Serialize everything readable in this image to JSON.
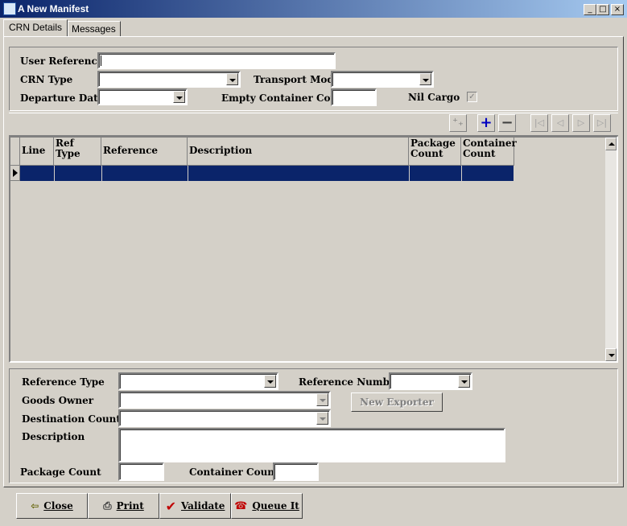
{
  "window": {
    "title": "A New Manifest",
    "controls": [
      "_",
      "□",
      "×"
    ]
  },
  "tabs": [
    {
      "label": "CRN Details"
    },
    {
      "label": "Messages"
    }
  ],
  "header_form": {
    "user_reference": {
      "label": "User Reference",
      "value": ""
    },
    "crn_type": {
      "label": "CRN Type",
      "value": ""
    },
    "transport_mode": {
      "label": "Transport Mode",
      "value": ""
    },
    "departure_date": {
      "label": "Departure Date",
      "value": ""
    },
    "empty_container_count": {
      "label": "Empty Container Count",
      "value": ""
    },
    "nil_cargo": {
      "label": "Nil Cargo",
      "checked": true
    }
  },
  "grid": {
    "columns": [
      {
        "label": "Line"
      },
      {
        "label": "Ref Type"
      },
      {
        "label": "Reference"
      },
      {
        "label": "Description"
      },
      {
        "label": "Package Count"
      },
      {
        "label": "Container Count"
      }
    ],
    "selected_row_color": "#0a246a"
  },
  "detail_form": {
    "reference_type": {
      "label": "Reference Type",
      "value": ""
    },
    "reference_number": {
      "label": "Reference Number",
      "value": ""
    },
    "goods_owner": {
      "label": "Goods Owner",
      "value": ""
    },
    "new_exporter_button": "New Exporter",
    "destination_country": {
      "label": "Destination Country",
      "value": ""
    },
    "description": {
      "label": "Description",
      "value": ""
    },
    "package_count": {
      "label": "Package Count",
      "value": ""
    },
    "container_count": {
      "label": "Container Count",
      "value": ""
    }
  },
  "footer_buttons": {
    "close": "Close",
    "print": "Print",
    "validate": "Validate",
    "queue_it": "Queue It"
  },
  "toolbar": {
    "icons": [
      "add-multiple-icon",
      "plus-icon",
      "minus-icon",
      "first-icon",
      "prev-icon",
      "next-icon",
      "last-icon"
    ]
  }
}
